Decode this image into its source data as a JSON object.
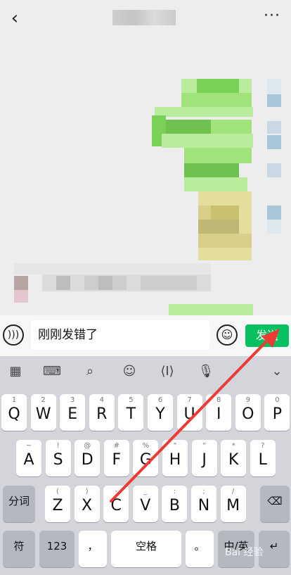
{
  "header": {
    "back_icon": "chevron-left-icon",
    "more_label": "···"
  },
  "input_bar": {
    "text": "刚刚发错了",
    "send_label": "发送"
  },
  "keyboard": {
    "row1": [
      {
        "k": "Q",
        "s": "1"
      },
      {
        "k": "W",
        "s": "2"
      },
      {
        "k": "E",
        "s": "3"
      },
      {
        "k": "R",
        "s": "4"
      },
      {
        "k": "T",
        "s": "5"
      },
      {
        "k": "Y",
        "s": "6"
      },
      {
        "k": "U",
        "s": "7"
      },
      {
        "k": "I",
        "s": "8"
      },
      {
        "k": "O",
        "s": "9"
      },
      {
        "k": "P",
        "s": "0"
      }
    ],
    "row2": [
      {
        "k": "A",
        "s": "~"
      },
      {
        "k": "S",
        "s": "!"
      },
      {
        "k": "D",
        "s": "@"
      },
      {
        "k": "F",
        "s": "#"
      },
      {
        "k": "G",
        "s": "%"
      },
      {
        "k": "H",
        "s": "\""
      },
      {
        "k": "J",
        "s": "\""
      },
      {
        "k": "K",
        "s": "*"
      },
      {
        "k": "L",
        "s": "?"
      }
    ],
    "row3": [
      {
        "k": "Z",
        "s": "("
      },
      {
        "k": "X",
        "s": ")"
      },
      {
        "k": "C",
        "s": "-"
      },
      {
        "k": "V",
        "s": "_"
      },
      {
        "k": "B",
        "s": ":"
      },
      {
        "k": "N",
        "s": ";"
      },
      {
        "k": "M",
        "s": "/"
      }
    ],
    "fenci_label": "分词",
    "fu_label": "符",
    "num_label": "123",
    "comma_label": "，",
    "space_label": "空格",
    "period_label": "。",
    "zhongying_label": "中/英",
    "enter_label": "↵",
    "backspace_label": "⌫"
  },
  "watermark": "Bai 经验"
}
